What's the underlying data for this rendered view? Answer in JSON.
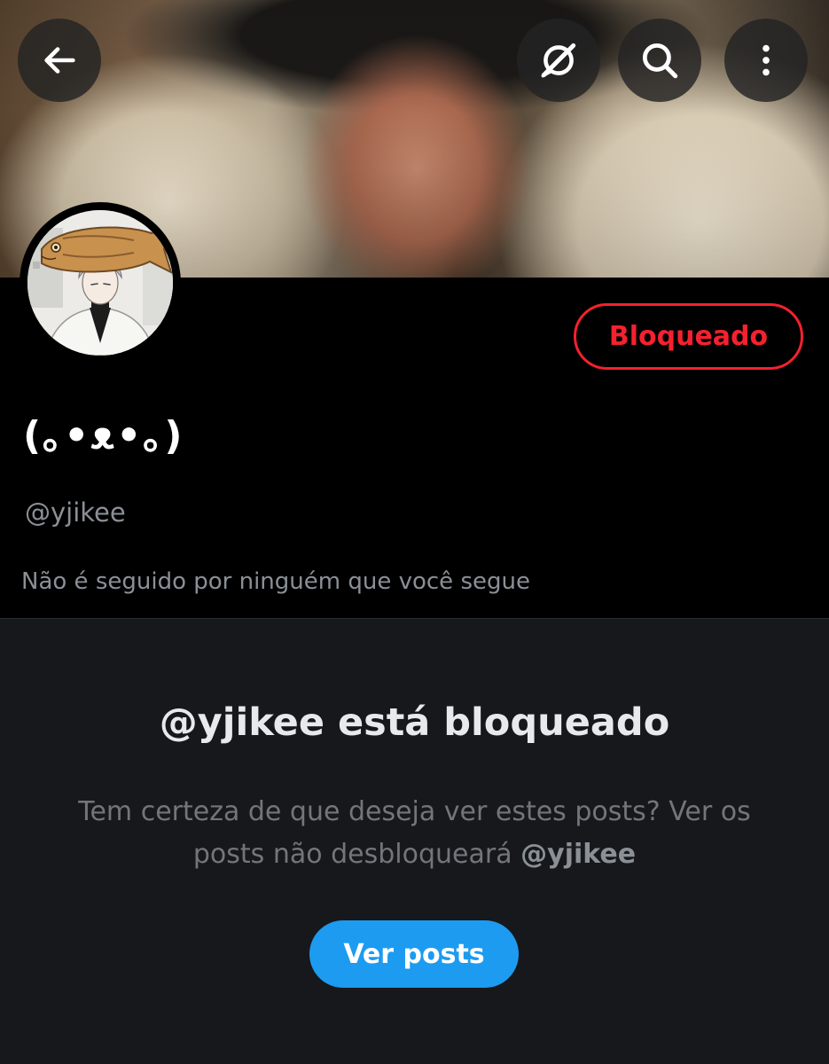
{
  "header": {
    "back_icon": "arrow-left-icon",
    "grok_icon": "grok-icon",
    "search_icon": "search-icon",
    "more_icon": "more-vertical-icon"
  },
  "profile": {
    "display_name": "(｡•ᴥ•｡)",
    "handle": "@yjikee",
    "blocked_button_label": "Bloqueado",
    "followed_by_text": "Não é seguido por ninguém que você segue"
  },
  "blocked_notice": {
    "title": "@yjikee está bloqueado",
    "description_prefix": "Tem certeza de que deseja ver estes posts? Ver os posts não desbloqueará ",
    "description_handle": "@yjikee",
    "view_posts_label": "Ver posts"
  },
  "colors": {
    "background": "#000000",
    "panel_background": "#16181c",
    "danger": "#f4212e",
    "accent": "#1d9bf0",
    "secondary_text": "#8b9096"
  }
}
